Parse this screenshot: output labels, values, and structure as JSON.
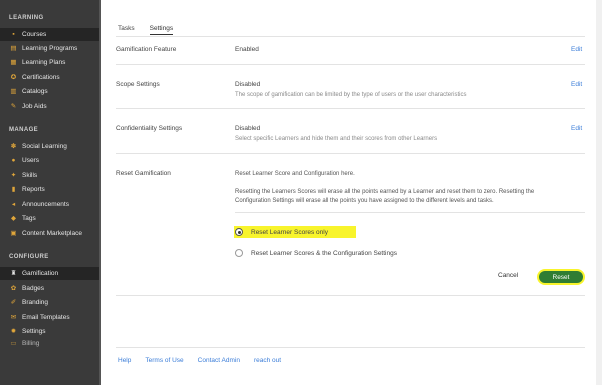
{
  "sidebar": {
    "sections": [
      {
        "title": "LEARNING",
        "items": [
          {
            "label": "Courses",
            "icon": "book-icon",
            "active": true
          },
          {
            "label": "Learning Programs",
            "icon": "programs-icon"
          },
          {
            "label": "Learning Plans",
            "icon": "plans-icon"
          },
          {
            "label": "Certifications",
            "icon": "certificate-icon"
          },
          {
            "label": "Catalogs",
            "icon": "catalog-icon"
          },
          {
            "label": "Job Aids",
            "icon": "pin-icon"
          }
        ]
      },
      {
        "title": "MANAGE",
        "items": [
          {
            "label": "Social Learning",
            "icon": "social-icon"
          },
          {
            "label": "Users",
            "icon": "users-icon"
          },
          {
            "label": "Skills",
            "icon": "skills-icon"
          },
          {
            "label": "Reports",
            "icon": "reports-icon"
          },
          {
            "label": "Announcements",
            "icon": "megaphone-icon"
          },
          {
            "label": "Tags",
            "icon": "tag-icon"
          },
          {
            "label": "Content Marketplace",
            "icon": "marketplace-icon"
          }
        ]
      },
      {
        "title": "CONFIGURE",
        "items": [
          {
            "label": "Gamification",
            "icon": "trophy-icon",
            "active": true
          },
          {
            "label": "Badges",
            "icon": "badge-icon"
          },
          {
            "label": "Branding",
            "icon": "brush-icon"
          },
          {
            "label": "Email Templates",
            "icon": "mail-icon"
          },
          {
            "label": "Settings",
            "icon": "gear-icon"
          },
          {
            "label": "Billing",
            "icon": "billing-icon"
          }
        ]
      }
    ]
  },
  "tabs": [
    {
      "label": "Tasks",
      "active": false
    },
    {
      "label": "Settings",
      "active": true
    }
  ],
  "settings": {
    "gamification": {
      "label": "Gamification Feature",
      "value": "Enabled",
      "edit": "Edit"
    },
    "scope": {
      "label": "Scope Settings",
      "value": "Disabled",
      "description": "The scope of gamification can be limited by the type of users or the user characteristics",
      "edit": "Edit"
    },
    "confidentiality": {
      "label": "Confidentiality Settings",
      "value": "Disabled",
      "description": "Select specific Learners and hide them and their scores from other Learners",
      "edit": "Edit"
    },
    "reset": {
      "label": "Reset Gamification",
      "heading": "Reset Learner Score and Configuration here.",
      "paragraph": "Resetting the Learners Scores will erase all the points earned by a Learner and reset them to zero. Resetting the Configuration Settings will erase all the points you have assigned to the different levels and tasks.",
      "options": [
        {
          "label": "Reset Learner Scores only",
          "selected": true
        },
        {
          "label": "Reset Learner Scores & the Configuration Settings",
          "selected": false
        }
      ],
      "cancel": "Cancel",
      "submit": "Reset"
    }
  },
  "footer": {
    "links": [
      "Help",
      "Terms of Use",
      "Contact Admin",
      "reach out"
    ]
  },
  "colors": {
    "sidebar_bg": "#3a3a3a",
    "link_blue": "#3b7dd8",
    "reset_green": "#2f7d33",
    "highlight_yellow": "#f8f42c"
  }
}
